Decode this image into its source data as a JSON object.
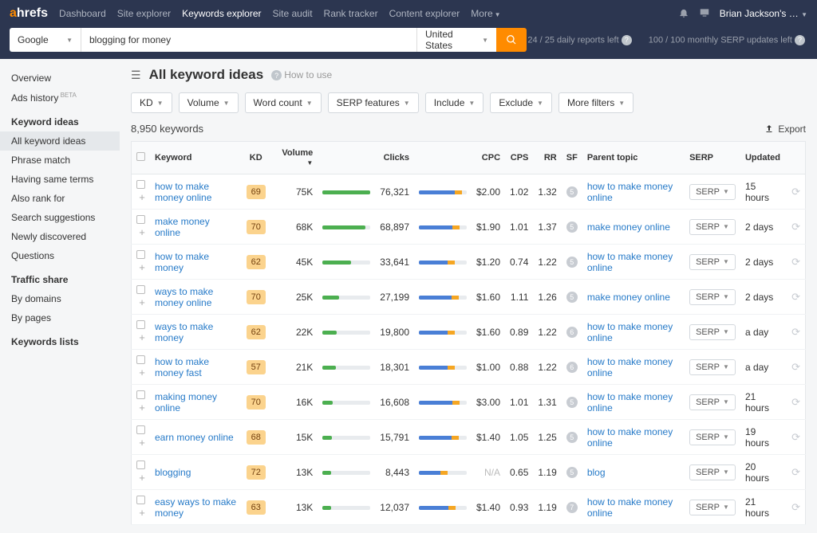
{
  "header": {
    "logo_a": "a",
    "logo_rest": "hrefs",
    "nav": [
      "Dashboard",
      "Site explorer",
      "Keywords explorer",
      "Site audit",
      "Rank tracker",
      "Content explorer",
      "More"
    ],
    "nav_active": 2,
    "user": "Brian Jackson's …"
  },
  "search": {
    "engine": "Google",
    "query": "blogging for money",
    "country": "United States",
    "stat1": "24 / 25 daily reports left",
    "stat2": "100 / 100 monthly SERP updates left"
  },
  "sidebar": {
    "items": [
      {
        "label": "Overview"
      },
      {
        "label": "Ads history",
        "badge": "BETA"
      },
      {
        "label": "Keyword ideas",
        "section": true
      },
      {
        "label": "All keyword ideas",
        "active": true
      },
      {
        "label": "Phrase match"
      },
      {
        "label": "Having same terms"
      },
      {
        "label": "Also rank for"
      },
      {
        "label": "Search suggestions"
      },
      {
        "label": "Newly discovered"
      },
      {
        "label": "Questions"
      },
      {
        "label": "Traffic share",
        "section": true
      },
      {
        "label": "By domains"
      },
      {
        "label": "By pages"
      },
      {
        "label": "Keywords lists",
        "section": true
      }
    ]
  },
  "page": {
    "title": "All keyword ideas",
    "howto": "How to use"
  },
  "filters": [
    "KD",
    "Volume",
    "Word count",
    "SERP features",
    "Include",
    "Exclude",
    "More filters"
  ],
  "results_count": "8,950 keywords",
  "export_label": "Export",
  "columns": {
    "keyword": "Keyword",
    "kd": "KD",
    "volume": "Volume",
    "clicks": "Clicks",
    "cpc": "CPC",
    "cps": "CPS",
    "rr": "RR",
    "sf": "SF",
    "parent": "Parent topic",
    "serp": "SERP",
    "updated": "Updated"
  },
  "serp_btn_label": "SERP",
  "rows": [
    {
      "keyword": "how to make money online",
      "kd": "69",
      "volume": "75K",
      "vbar": 100,
      "clicks": "76,321",
      "cbar": 75,
      "cpc": "$2.00",
      "cps": "1.02",
      "rr": "1.32",
      "sf": "5",
      "parent": "how to make money online",
      "updated": "15 hours"
    },
    {
      "keyword": "make money online",
      "kd": "70",
      "volume": "68K",
      "vbar": 90,
      "clicks": "68,897",
      "cbar": 70,
      "cpc": "$1.90",
      "cps": "1.01",
      "rr": "1.37",
      "sf": "5",
      "parent": "make money online",
      "updated": "2 days"
    },
    {
      "keyword": "how to make money",
      "kd": "62",
      "volume": "45K",
      "vbar": 60,
      "clicks": "33,641",
      "cbar": 60,
      "cpc": "$1.20",
      "cps": "0.74",
      "rr": "1.22",
      "sf": "5",
      "parent": "how to make money online",
      "updated": "2 days"
    },
    {
      "keyword": "ways to make money online",
      "kd": "70",
      "volume": "25K",
      "vbar": 35,
      "clicks": "27,199",
      "cbar": 68,
      "cpc": "$1.60",
      "cps": "1.11",
      "rr": "1.26",
      "sf": "5",
      "parent": "make money online",
      "updated": "2 days"
    },
    {
      "keyword": "ways to make money",
      "kd": "62",
      "volume": "22K",
      "vbar": 30,
      "clicks": "19,800",
      "cbar": 60,
      "cpc": "$1.60",
      "cps": "0.89",
      "rr": "1.22",
      "sf": "6",
      "parent": "how to make money online",
      "updated": "a day"
    },
    {
      "keyword": "how to make money fast",
      "kd": "57",
      "volume": "21K",
      "vbar": 28,
      "clicks": "18,301",
      "cbar": 60,
      "cpc": "$1.00",
      "cps": "0.88",
      "rr": "1.22",
      "sf": "6",
      "parent": "how to make money online",
      "updated": "a day"
    },
    {
      "keyword": "making money online",
      "kd": "70",
      "volume": "16K",
      "vbar": 22,
      "clicks": "16,608",
      "cbar": 70,
      "cpc": "$3.00",
      "cps": "1.01",
      "rr": "1.31",
      "sf": "5",
      "parent": "how to make money online",
      "updated": "21 hours"
    },
    {
      "keyword": "earn money online",
      "kd": "68",
      "volume": "15K",
      "vbar": 20,
      "clicks": "15,791",
      "cbar": 68,
      "cpc": "$1.40",
      "cps": "1.05",
      "rr": "1.25",
      "sf": "5",
      "parent": "how to make money online",
      "updated": "19 hours"
    },
    {
      "keyword": "blogging",
      "kd": "72",
      "volume": "13K",
      "vbar": 18,
      "clicks": "8,443",
      "cbar": 45,
      "cpc": "N/A",
      "cps": "0.65",
      "rr": "1.19",
      "sf": "5",
      "parent": "blog",
      "updated": "20 hours"
    },
    {
      "keyword": "easy ways to make money",
      "kd": "63",
      "volume": "13K",
      "vbar": 18,
      "clicks": "12,037",
      "cbar": 62,
      "cpc": "$1.40",
      "cps": "0.93",
      "rr": "1.19",
      "sf": "7",
      "parent": "how to make money online",
      "updated": "21 hours"
    }
  ]
}
